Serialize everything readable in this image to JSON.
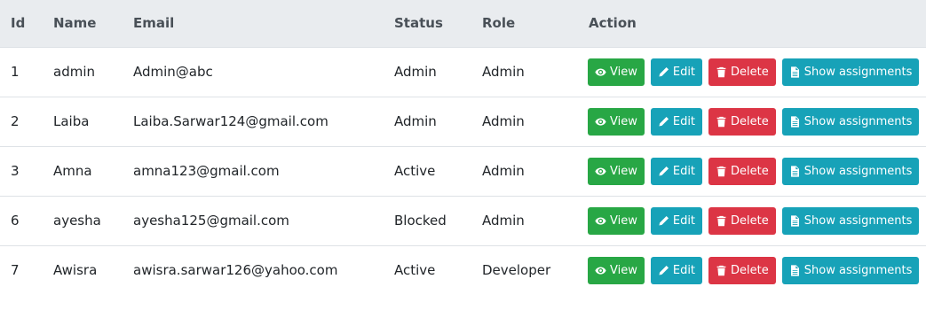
{
  "headers": {
    "id": "Id",
    "name": "Name",
    "email": "Email",
    "status": "Status",
    "role": "Role",
    "action": "Action"
  },
  "buttons": {
    "view": "View",
    "edit": "Edit",
    "delete": "Delete",
    "show_assignments": "Show assignments"
  },
  "icons": {
    "view": "eye-icon",
    "edit": "pencil-icon",
    "delete": "trash-icon",
    "show_assignments": "document-icon"
  },
  "colors": {
    "view": "#28a745",
    "edit": "#17a2b8",
    "delete": "#dc3545",
    "show_assignments": "#17a2b8",
    "header_bg": "#e9ecef"
  },
  "rows": [
    {
      "id": "1",
      "name": "admin",
      "email": "Admin@abc",
      "status": "Admin",
      "role": "Admin"
    },
    {
      "id": "2",
      "name": "Laiba",
      "email": "Laiba.Sarwar124@gmail.com",
      "status": "Admin",
      "role": "Admin"
    },
    {
      "id": "3",
      "name": "Amna",
      "email": "amna123@gmail.com",
      "status": "Active",
      "role": "Admin"
    },
    {
      "id": "6",
      "name": "ayesha",
      "email": "ayesha125@gmail.com",
      "status": "Blocked",
      "role": "Admin"
    },
    {
      "id": "7",
      "name": "Awisra",
      "email": "awisra.sarwar126@yahoo.com",
      "status": "Active",
      "role": "Developer"
    }
  ]
}
